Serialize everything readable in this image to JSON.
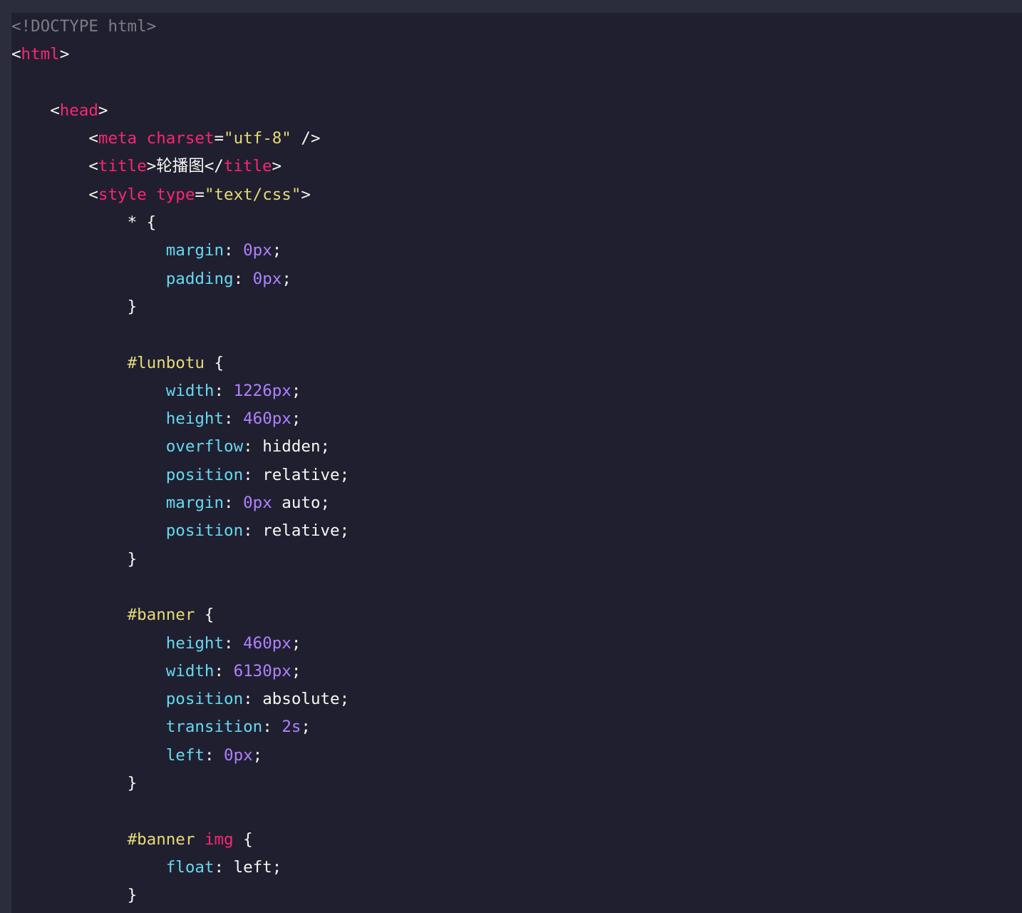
{
  "editor": {
    "theme_colors": {
      "background": "#201f30",
      "frame": "#2b2d3d",
      "tag": "#f92672",
      "string": "#e6db74",
      "property": "#66d9ef",
      "number": "#ae81ff",
      "comment": "#7c7c85",
      "text": "#f8f8f2"
    },
    "lines": [
      [
        {
          "t": "doctype",
          "v": "<!DOCTYPE html>"
        }
      ],
      [
        {
          "t": "punct",
          "v": "<"
        },
        {
          "t": "tag",
          "v": "html"
        },
        {
          "t": "punct",
          "v": ">"
        }
      ],
      [],
      [
        {
          "t": "text",
          "v": "    "
        },
        {
          "t": "punct",
          "v": "<"
        },
        {
          "t": "tag",
          "v": "head"
        },
        {
          "t": "punct",
          "v": ">"
        }
      ],
      [
        {
          "t": "text",
          "v": "        "
        },
        {
          "t": "punct",
          "v": "<"
        },
        {
          "t": "tag",
          "v": "meta"
        },
        {
          "t": "text",
          "v": " "
        },
        {
          "t": "attr",
          "v": "charset"
        },
        {
          "t": "punct",
          "v": "="
        },
        {
          "t": "str",
          "v": "\"utf-8\""
        },
        {
          "t": "punct",
          "v": " />"
        }
      ],
      [
        {
          "t": "text",
          "v": "        "
        },
        {
          "t": "punct",
          "v": "<"
        },
        {
          "t": "tag",
          "v": "title"
        },
        {
          "t": "punct",
          "v": ">"
        },
        {
          "t": "text",
          "v": "轮播图"
        },
        {
          "t": "punct",
          "v": "</"
        },
        {
          "t": "tag",
          "v": "title"
        },
        {
          "t": "punct",
          "v": ">"
        }
      ],
      [
        {
          "t": "text",
          "v": "        "
        },
        {
          "t": "punct",
          "v": "<"
        },
        {
          "t": "tag",
          "v": "style"
        },
        {
          "t": "text",
          "v": " "
        },
        {
          "t": "attr",
          "v": "type"
        },
        {
          "t": "punct",
          "v": "="
        },
        {
          "t": "str",
          "v": "\"text/css\""
        },
        {
          "t": "punct",
          "v": ">"
        }
      ],
      [
        {
          "t": "text",
          "v": "            "
        },
        {
          "t": "brace",
          "v": "* {"
        }
      ],
      [
        {
          "t": "text",
          "v": "                "
        },
        {
          "t": "prop",
          "v": "margin"
        },
        {
          "t": "punct",
          "v": ": "
        },
        {
          "t": "num",
          "v": "0px"
        },
        {
          "t": "punct",
          "v": ";"
        }
      ],
      [
        {
          "t": "text",
          "v": "                "
        },
        {
          "t": "prop",
          "v": "padding"
        },
        {
          "t": "punct",
          "v": ": "
        },
        {
          "t": "num",
          "v": "0px"
        },
        {
          "t": "punct",
          "v": ";"
        }
      ],
      [
        {
          "t": "text",
          "v": "            "
        },
        {
          "t": "brace",
          "v": "}"
        }
      ],
      [],
      [
        {
          "t": "text",
          "v": "            "
        },
        {
          "t": "sel",
          "v": "#lunbotu"
        },
        {
          "t": "brace",
          "v": " {"
        }
      ],
      [
        {
          "t": "text",
          "v": "                "
        },
        {
          "t": "prop",
          "v": "width"
        },
        {
          "t": "punct",
          "v": ": "
        },
        {
          "t": "num",
          "v": "1226px"
        },
        {
          "t": "punct",
          "v": ";"
        }
      ],
      [
        {
          "t": "text",
          "v": "                "
        },
        {
          "t": "prop",
          "v": "height"
        },
        {
          "t": "punct",
          "v": ": "
        },
        {
          "t": "num",
          "v": "460px"
        },
        {
          "t": "punct",
          "v": ";"
        }
      ],
      [
        {
          "t": "text",
          "v": "                "
        },
        {
          "t": "prop",
          "v": "overflow"
        },
        {
          "t": "punct",
          "v": ": "
        },
        {
          "t": "val",
          "v": "hidden"
        },
        {
          "t": "punct",
          "v": ";"
        }
      ],
      [
        {
          "t": "text",
          "v": "                "
        },
        {
          "t": "prop",
          "v": "position"
        },
        {
          "t": "punct",
          "v": ": "
        },
        {
          "t": "val",
          "v": "relative"
        },
        {
          "t": "punct",
          "v": ";"
        }
      ],
      [
        {
          "t": "text",
          "v": "                "
        },
        {
          "t": "prop",
          "v": "margin"
        },
        {
          "t": "punct",
          "v": ": "
        },
        {
          "t": "num",
          "v": "0px"
        },
        {
          "t": "val",
          "v": " auto"
        },
        {
          "t": "punct",
          "v": ";"
        }
      ],
      [
        {
          "t": "text",
          "v": "                "
        },
        {
          "t": "prop",
          "v": "position"
        },
        {
          "t": "punct",
          "v": ": "
        },
        {
          "t": "val",
          "v": "relative"
        },
        {
          "t": "punct",
          "v": ";"
        }
      ],
      [
        {
          "t": "text",
          "v": "            "
        },
        {
          "t": "brace",
          "v": "}"
        }
      ],
      [],
      [
        {
          "t": "text",
          "v": "            "
        },
        {
          "t": "sel",
          "v": "#banner"
        },
        {
          "t": "brace",
          "v": " {"
        }
      ],
      [
        {
          "t": "text",
          "v": "                "
        },
        {
          "t": "prop",
          "v": "height"
        },
        {
          "t": "punct",
          "v": ": "
        },
        {
          "t": "num",
          "v": "460px"
        },
        {
          "t": "punct",
          "v": ";"
        }
      ],
      [
        {
          "t": "text",
          "v": "                "
        },
        {
          "t": "prop",
          "v": "width"
        },
        {
          "t": "punct",
          "v": ": "
        },
        {
          "t": "num",
          "v": "6130px"
        },
        {
          "t": "punct",
          "v": ";"
        }
      ],
      [
        {
          "t": "text",
          "v": "                "
        },
        {
          "t": "prop",
          "v": "position"
        },
        {
          "t": "punct",
          "v": ": "
        },
        {
          "t": "val",
          "v": "absolute"
        },
        {
          "t": "punct",
          "v": ";"
        }
      ],
      [
        {
          "t": "text",
          "v": "                "
        },
        {
          "t": "prop",
          "v": "transition"
        },
        {
          "t": "punct",
          "v": ": "
        },
        {
          "t": "num",
          "v": "2s"
        },
        {
          "t": "punct",
          "v": ";"
        }
      ],
      [
        {
          "t": "text",
          "v": "                "
        },
        {
          "t": "prop",
          "v": "left"
        },
        {
          "t": "punct",
          "v": ": "
        },
        {
          "t": "num",
          "v": "0px"
        },
        {
          "t": "punct",
          "v": ";"
        }
      ],
      [
        {
          "t": "text",
          "v": "            "
        },
        {
          "t": "brace",
          "v": "}"
        }
      ],
      [],
      [
        {
          "t": "text",
          "v": "            "
        },
        {
          "t": "sel",
          "v": "#banner"
        },
        {
          "t": "text",
          "v": " "
        },
        {
          "t": "tag",
          "v": "img"
        },
        {
          "t": "brace",
          "v": " {"
        }
      ],
      [
        {
          "t": "text",
          "v": "                "
        },
        {
          "t": "prop",
          "v": "float"
        },
        {
          "t": "punct",
          "v": ": "
        },
        {
          "t": "val",
          "v": "left"
        },
        {
          "t": "punct",
          "v": ";"
        }
      ],
      [
        {
          "t": "text",
          "v": "            "
        },
        {
          "t": "brace",
          "v": "}"
        }
      ]
    ]
  }
}
